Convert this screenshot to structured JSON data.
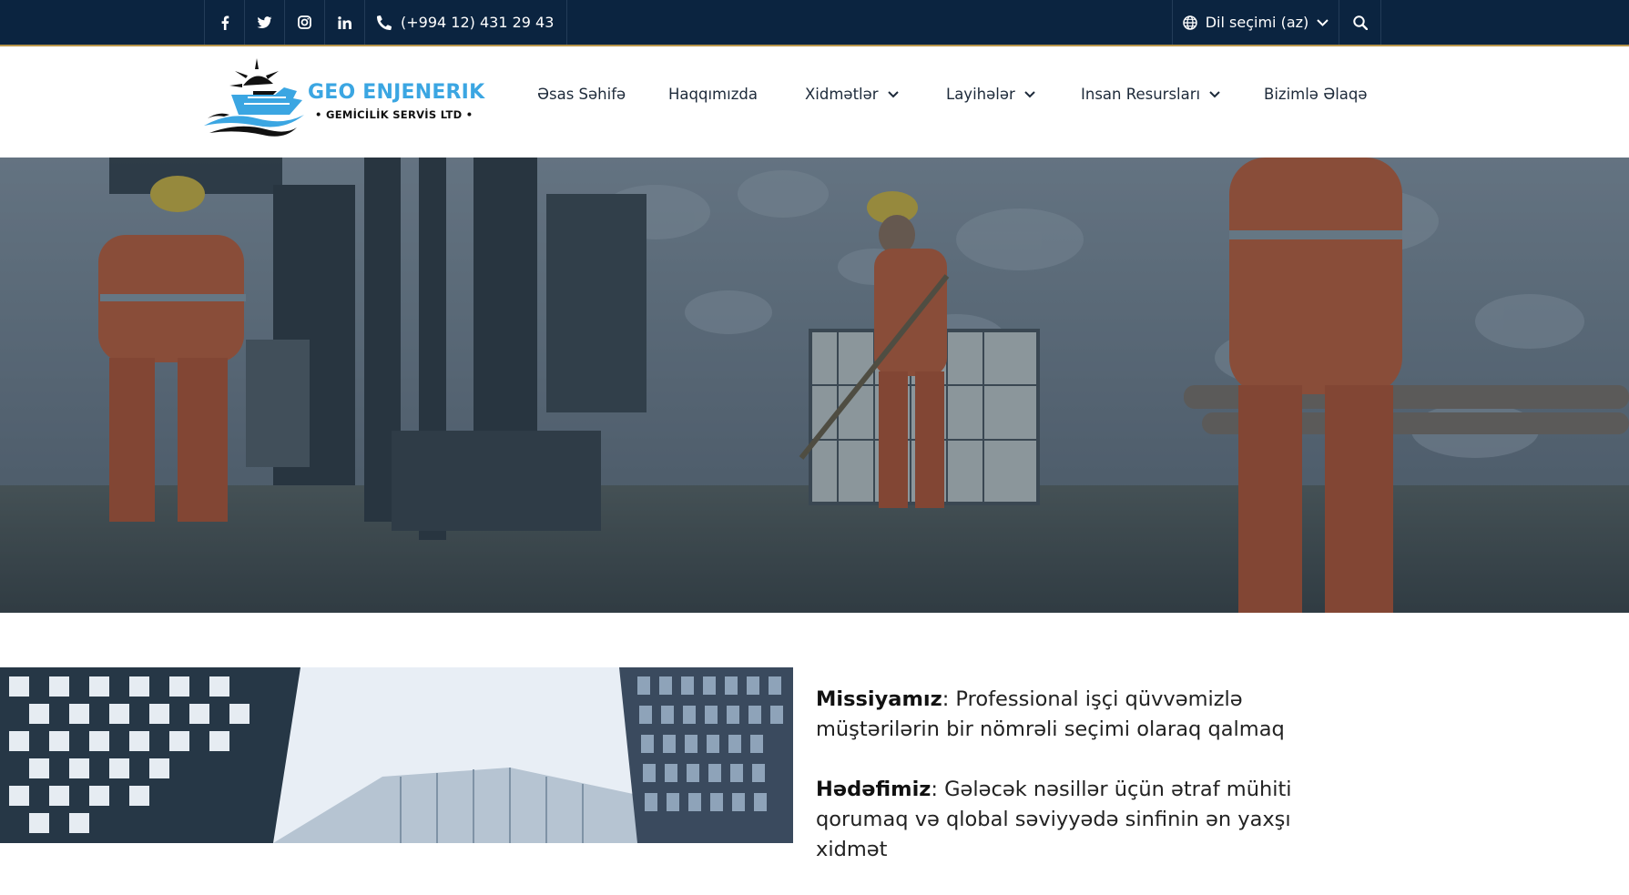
{
  "topbar": {
    "social": [
      {
        "icon": "facebook-icon"
      },
      {
        "icon": "twitter-icon"
      },
      {
        "icon": "instagram-icon"
      },
      {
        "icon": "linkedin-icon"
      }
    ],
    "phone": "(+994 12) 431 29 43",
    "language_label": "Dil seçimi (az)"
  },
  "logo": {
    "name": "GEO ENJENERIK",
    "subtitle": "• GEMİCİLİK SERVİS LTD •"
  },
  "nav": {
    "items": [
      {
        "label": "Əsas Səhifə",
        "has_dropdown": false
      },
      {
        "label": "Haqqımızda",
        "has_dropdown": false
      },
      {
        "label": "Xidmətlər",
        "has_dropdown": true
      },
      {
        "label": "Layihələr",
        "has_dropdown": true
      },
      {
        "label": "Insan Resursları",
        "has_dropdown": true
      },
      {
        "label": "Bizimlə Əlaqə",
        "has_dropdown": false
      }
    ]
  },
  "slider": {
    "slide_count": 5,
    "active_index": 1
  },
  "content": {
    "mission_title": "Missiyamız",
    "mission_text": ": Professional işçi qüvvəmizlə müştərilərin bir nömrəli seçimi olaraq qalmaq",
    "goal_title": "Hədəfimiz",
    "goal_text": ": Gələcək nəsillər üçün ətraf mühiti qorumaq və qlobal səviyyədə sinfinin ən yaxşı xidmət"
  },
  "colors": {
    "topbar_bg": "#0b2440",
    "accent_gold": "#c9a063",
    "logo_blue": "#3ba6e2"
  }
}
